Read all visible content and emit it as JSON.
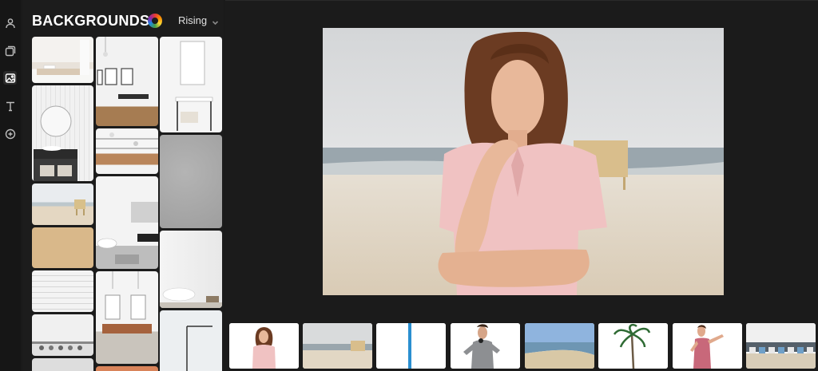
{
  "panel": {
    "title": "BACKGROUNDS",
    "sort_value": "Rising"
  },
  "rail": {
    "icons": [
      "user-icon",
      "layers-icon",
      "image-icon",
      "text-icon",
      "add-icon"
    ],
    "active": "image-icon"
  },
  "colors": {
    "app_bg": "#1a1a1a",
    "panel_bg": "#1c1c1c",
    "accent_blue": "#2a8fd0"
  },
  "filmstrip": {
    "items": [
      "woman-pink-blouse",
      "beach-lifeguard-tower",
      "blue-pole",
      "man-gray-jacket",
      "beach-shore",
      "palm-tree",
      "woman-pink-dress",
      "beach-huts"
    ]
  }
}
